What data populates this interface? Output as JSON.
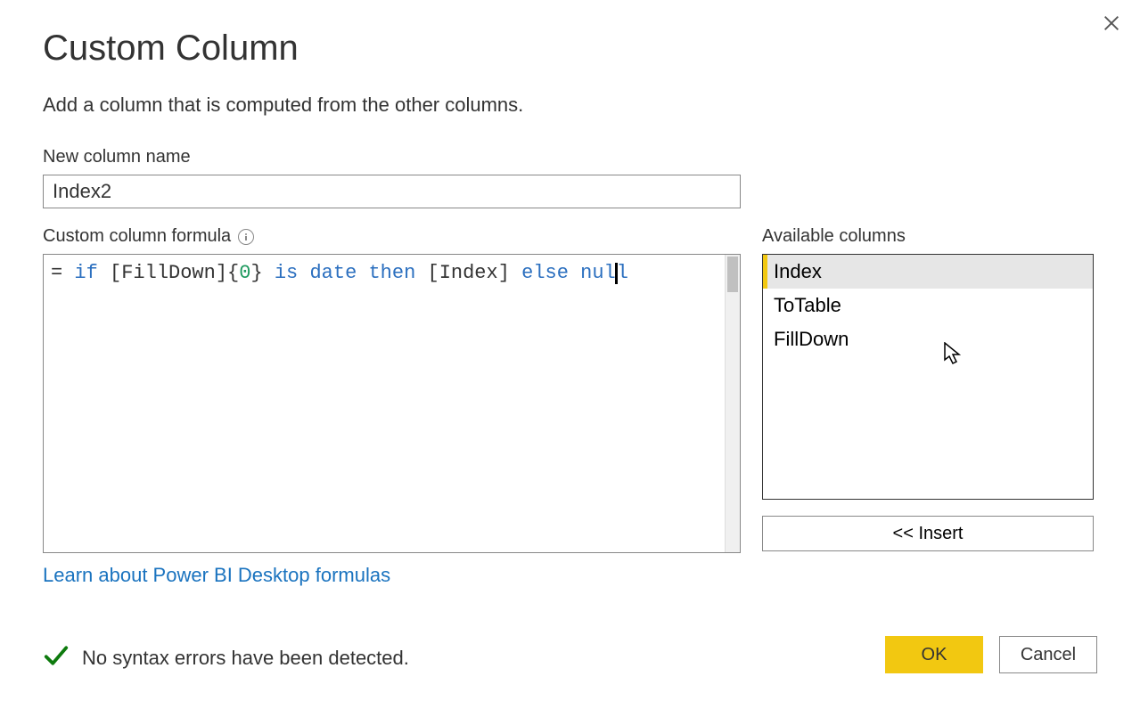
{
  "dialog": {
    "title": "Custom Column",
    "subtitle": "Add a column that is computed from the other columns.",
    "close_label": "Close"
  },
  "name_field": {
    "label": "New column name",
    "value": "Index2"
  },
  "formula_field": {
    "label": "Custom column formula",
    "tokens": {
      "eq": "= ",
      "if": "if",
      "sp1": " [FillDown]{",
      "zero": "0",
      "sp2": "} ",
      "is": "is",
      "sp3": " ",
      "date": "date",
      "sp4": " ",
      "then": "then",
      "sp5": " [Index] ",
      "else": "else",
      "sp6": " ",
      "nul_pre": "nul",
      "nul_post": "l"
    }
  },
  "available_columns": {
    "label": "Available columns",
    "items": [
      {
        "name": "Index",
        "selected": true
      },
      {
        "name": "ToTable",
        "selected": false
      },
      {
        "name": "FillDown",
        "selected": false
      }
    ],
    "insert_label": "<< Insert"
  },
  "learn_link": "Learn about Power BI Desktop formulas",
  "status": {
    "message": "No syntax errors have been detected."
  },
  "buttons": {
    "ok": "OK",
    "cancel": "Cancel"
  }
}
